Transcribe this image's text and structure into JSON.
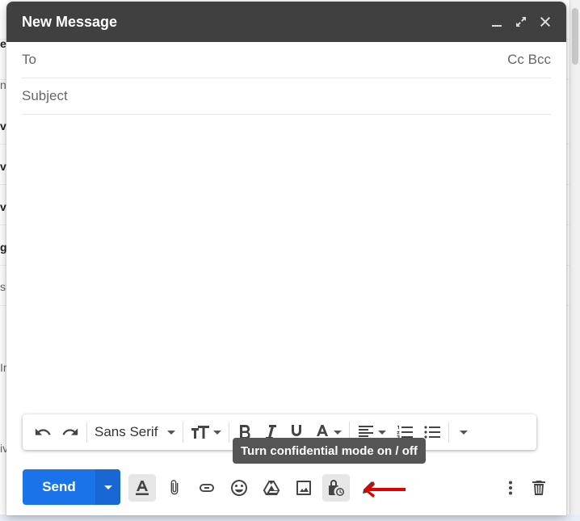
{
  "background": {
    "fragments": [
      "es",
      "n",
      "v",
      "v",
      "v",
      "g",
      "sl",
      "Ir",
      "iv"
    ]
  },
  "compose": {
    "title": "New Message",
    "to_label": "To",
    "cc_bcc": "Cc Bcc",
    "subject_placeholder": "Subject",
    "body": ""
  },
  "formatting": {
    "font": "Sans Serif"
  },
  "tooltip": "Turn confidential mode on / off",
  "actions": {
    "send_label": "Send"
  },
  "icons": {
    "minimize": "minimize-icon",
    "expand": "expand-icon",
    "close": "close-icon",
    "undo": "undo-icon",
    "redo": "redo-icon",
    "text_size": "text-size-icon",
    "bold": "bold-icon",
    "italic": "italic-icon",
    "underline": "underline-icon",
    "text_color": "text-color-icon",
    "align": "align-icon",
    "numbered_list": "numbered-list-icon",
    "bulleted_list": "bulleted-list-icon",
    "more_formatting": "more-formatting-icon",
    "formatting_options": "formatting-options-icon",
    "attach": "paperclip-icon",
    "link": "link-icon",
    "emoji": "emoji-icon",
    "drive": "drive-icon",
    "photo": "photo-icon",
    "confidential": "confidential-mode-icon",
    "signature": "signature-pen-icon",
    "more_options": "more-vert-icon",
    "discard": "trash-icon",
    "annotation": "red-arrow-icon"
  },
  "colors": {
    "titlebar": "#404040",
    "send": "#1a73e8",
    "tooltip": "#555555",
    "annotation_arrow": "#e00000"
  }
}
